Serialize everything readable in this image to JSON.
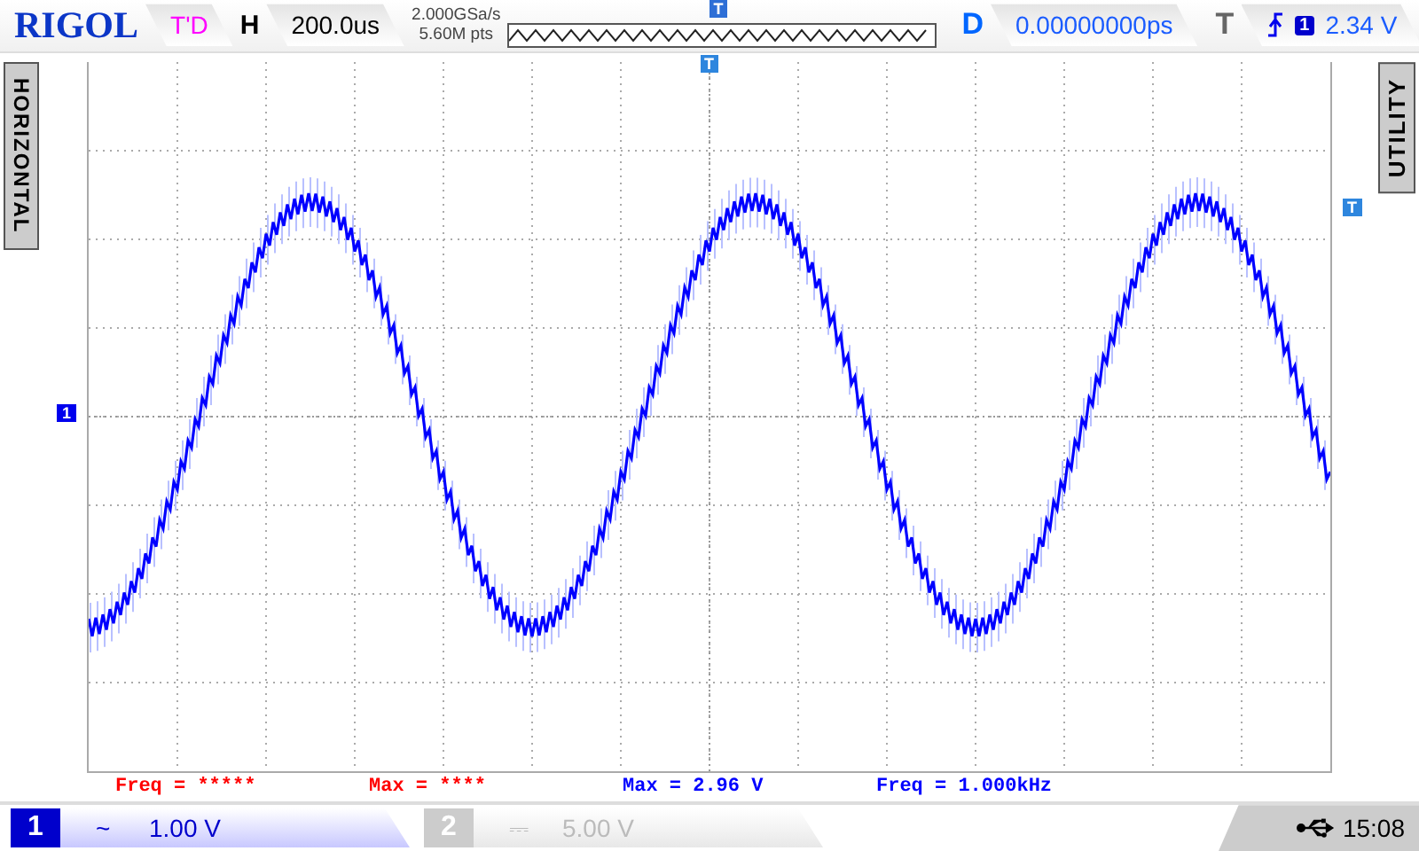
{
  "header": {
    "logo": "RIGOL",
    "run_status": "T'D",
    "horizontal_label": "H",
    "timebase": "200.0us",
    "sample_rate": "2.000GSa/s",
    "memory_depth": "5.60M pts",
    "trigger_position_marker": "T",
    "delay_label": "D",
    "delay": "0.00000000ps",
    "trigger_label": "T",
    "trigger_source": "1",
    "trigger_level": "2.34 V"
  },
  "side_tabs": {
    "left": "HORIZONTAL",
    "right": "UTILITY"
  },
  "markers": {
    "channel": "1",
    "trigger_top": "T",
    "trigger_level": "T"
  },
  "measurements": [
    {
      "text": "Freq = *****",
      "color": "#ff0000"
    },
    {
      "text": "Max = ****",
      "color": "#ff0000"
    },
    {
      "text": "Max = 2.96 V",
      "color": "#0000ff"
    },
    {
      "text": "Freq = 1.000kHz",
      "color": "#0000ff"
    }
  ],
  "channels": [
    {
      "number": "1",
      "coupling": "~",
      "scale": "1.00 V",
      "enabled": true
    },
    {
      "number": "2",
      "coupling": "⎓",
      "scale": "5.00 V",
      "enabled": false
    }
  ],
  "status": {
    "time": "15:08"
  }
}
